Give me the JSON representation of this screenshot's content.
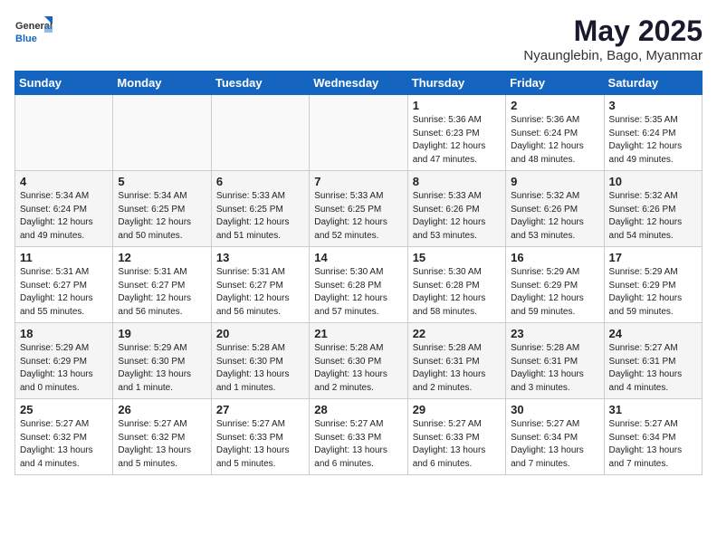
{
  "logo": {
    "line1": "General",
    "line2": "Blue"
  },
  "header": {
    "month": "May 2025",
    "location": "Nyaunglebin, Bago, Myanmar"
  },
  "weekdays": [
    "Sunday",
    "Monday",
    "Tuesday",
    "Wednesday",
    "Thursday",
    "Friday",
    "Saturday"
  ],
  "weeks": [
    [
      {
        "day": "",
        "info": ""
      },
      {
        "day": "",
        "info": ""
      },
      {
        "day": "",
        "info": ""
      },
      {
        "day": "",
        "info": ""
      },
      {
        "day": "1",
        "info": "Sunrise: 5:36 AM\nSunset: 6:23 PM\nDaylight: 12 hours\nand 47 minutes."
      },
      {
        "day": "2",
        "info": "Sunrise: 5:36 AM\nSunset: 6:24 PM\nDaylight: 12 hours\nand 48 minutes."
      },
      {
        "day": "3",
        "info": "Sunrise: 5:35 AM\nSunset: 6:24 PM\nDaylight: 12 hours\nand 49 minutes."
      }
    ],
    [
      {
        "day": "4",
        "info": "Sunrise: 5:34 AM\nSunset: 6:24 PM\nDaylight: 12 hours\nand 49 minutes."
      },
      {
        "day": "5",
        "info": "Sunrise: 5:34 AM\nSunset: 6:25 PM\nDaylight: 12 hours\nand 50 minutes."
      },
      {
        "day": "6",
        "info": "Sunrise: 5:33 AM\nSunset: 6:25 PM\nDaylight: 12 hours\nand 51 minutes."
      },
      {
        "day": "7",
        "info": "Sunrise: 5:33 AM\nSunset: 6:25 PM\nDaylight: 12 hours\nand 52 minutes."
      },
      {
        "day": "8",
        "info": "Sunrise: 5:33 AM\nSunset: 6:26 PM\nDaylight: 12 hours\nand 53 minutes."
      },
      {
        "day": "9",
        "info": "Sunrise: 5:32 AM\nSunset: 6:26 PM\nDaylight: 12 hours\nand 53 minutes."
      },
      {
        "day": "10",
        "info": "Sunrise: 5:32 AM\nSunset: 6:26 PM\nDaylight: 12 hours\nand 54 minutes."
      }
    ],
    [
      {
        "day": "11",
        "info": "Sunrise: 5:31 AM\nSunset: 6:27 PM\nDaylight: 12 hours\nand 55 minutes."
      },
      {
        "day": "12",
        "info": "Sunrise: 5:31 AM\nSunset: 6:27 PM\nDaylight: 12 hours\nand 56 minutes."
      },
      {
        "day": "13",
        "info": "Sunrise: 5:31 AM\nSunset: 6:27 PM\nDaylight: 12 hours\nand 56 minutes."
      },
      {
        "day": "14",
        "info": "Sunrise: 5:30 AM\nSunset: 6:28 PM\nDaylight: 12 hours\nand 57 minutes."
      },
      {
        "day": "15",
        "info": "Sunrise: 5:30 AM\nSunset: 6:28 PM\nDaylight: 12 hours\nand 58 minutes."
      },
      {
        "day": "16",
        "info": "Sunrise: 5:29 AM\nSunset: 6:29 PM\nDaylight: 12 hours\nand 59 minutes."
      },
      {
        "day": "17",
        "info": "Sunrise: 5:29 AM\nSunset: 6:29 PM\nDaylight: 12 hours\nand 59 minutes."
      }
    ],
    [
      {
        "day": "18",
        "info": "Sunrise: 5:29 AM\nSunset: 6:29 PM\nDaylight: 13 hours\nand 0 minutes."
      },
      {
        "day": "19",
        "info": "Sunrise: 5:29 AM\nSunset: 6:30 PM\nDaylight: 13 hours\nand 1 minute."
      },
      {
        "day": "20",
        "info": "Sunrise: 5:28 AM\nSunset: 6:30 PM\nDaylight: 13 hours\nand 1 minutes."
      },
      {
        "day": "21",
        "info": "Sunrise: 5:28 AM\nSunset: 6:30 PM\nDaylight: 13 hours\nand 2 minutes."
      },
      {
        "day": "22",
        "info": "Sunrise: 5:28 AM\nSunset: 6:31 PM\nDaylight: 13 hours\nand 2 minutes."
      },
      {
        "day": "23",
        "info": "Sunrise: 5:28 AM\nSunset: 6:31 PM\nDaylight: 13 hours\nand 3 minutes."
      },
      {
        "day": "24",
        "info": "Sunrise: 5:27 AM\nSunset: 6:31 PM\nDaylight: 13 hours\nand 4 minutes."
      }
    ],
    [
      {
        "day": "25",
        "info": "Sunrise: 5:27 AM\nSunset: 6:32 PM\nDaylight: 13 hours\nand 4 minutes."
      },
      {
        "day": "26",
        "info": "Sunrise: 5:27 AM\nSunset: 6:32 PM\nDaylight: 13 hours\nand 5 minutes."
      },
      {
        "day": "27",
        "info": "Sunrise: 5:27 AM\nSunset: 6:33 PM\nDaylight: 13 hours\nand 5 minutes."
      },
      {
        "day": "28",
        "info": "Sunrise: 5:27 AM\nSunset: 6:33 PM\nDaylight: 13 hours\nand 6 minutes."
      },
      {
        "day": "29",
        "info": "Sunrise: 5:27 AM\nSunset: 6:33 PM\nDaylight: 13 hours\nand 6 minutes."
      },
      {
        "day": "30",
        "info": "Sunrise: 5:27 AM\nSunset: 6:34 PM\nDaylight: 13 hours\nand 7 minutes."
      },
      {
        "day": "31",
        "info": "Sunrise: 5:27 AM\nSunset: 6:34 PM\nDaylight: 13 hours\nand 7 minutes."
      }
    ]
  ]
}
